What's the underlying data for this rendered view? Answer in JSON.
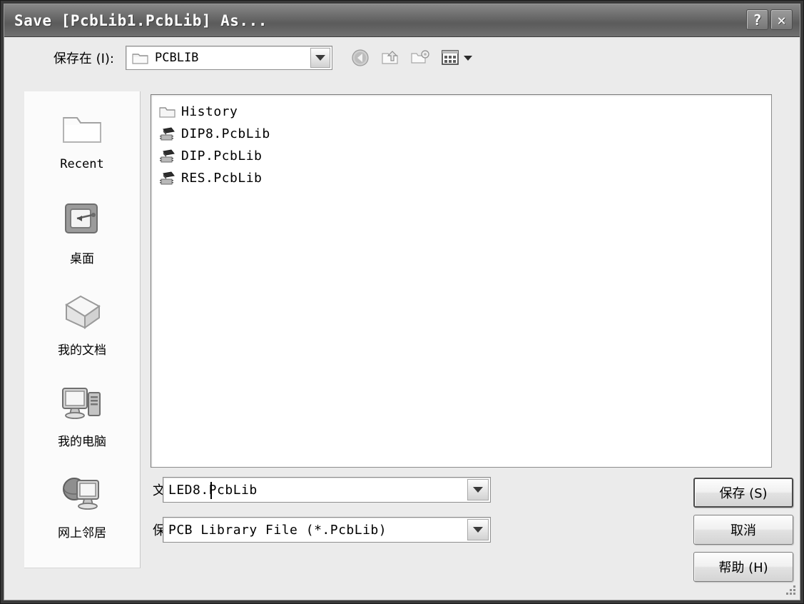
{
  "window": {
    "title": "Save [PcbLib1.PcbLib] As...",
    "help_button": "?",
    "close_button": "✕"
  },
  "lookin": {
    "label": "保存在 (I):",
    "value": "PCBLIB",
    "folder_icon": "folder-icon",
    "toolbar": [
      {
        "name": "back-icon",
        "title": "后退"
      },
      {
        "name": "up-folder-icon",
        "title": "向上一级"
      },
      {
        "name": "new-folder-icon",
        "title": "新建文件夹"
      },
      {
        "name": "views-icon",
        "title": "查看"
      }
    ]
  },
  "places": [
    {
      "label": "Recent",
      "icon": "recent-folder-icon",
      "latin": true
    },
    {
      "label": "桌面",
      "icon": "desktop-icon",
      "latin": false
    },
    {
      "label": "我的文档",
      "icon": "my-documents-icon",
      "latin": false
    },
    {
      "label": "我的电脑",
      "icon": "my-computer-icon",
      "latin": false
    },
    {
      "label": "网上邻居",
      "icon": "network-places-icon",
      "latin": false
    }
  ],
  "files": [
    {
      "name": "History",
      "icon": "folder-icon",
      "type": "folder"
    },
    {
      "name": "DIP8.PcbLib",
      "icon": "pcblib-file-icon",
      "type": "file"
    },
    {
      "name": "DIP.PcbLib",
      "icon": "pcblib-file-icon",
      "type": "file"
    },
    {
      "name": "RES.PcbLib",
      "icon": "pcblib-file-icon",
      "type": "file"
    }
  ],
  "filename": {
    "label": "文件名 (N):",
    "value": "LED8.PcbLib",
    "placeholder": ""
  },
  "filetype": {
    "label": "保存类型 (T):",
    "value": "PCB Library File (*.PcbLib)",
    "options": [
      "PCB Library File (*.PcbLib)"
    ]
  },
  "buttons": {
    "save": "保存 (S)",
    "cancel": "取消",
    "help": "帮助 (H)"
  },
  "colors": {
    "titlebar": "#6d6d6d",
    "dialog_bg": "#ebebeb",
    "places_bg": "#fbfbfb",
    "list_bg": "#ffffff",
    "frame": "#3a3a3a"
  }
}
